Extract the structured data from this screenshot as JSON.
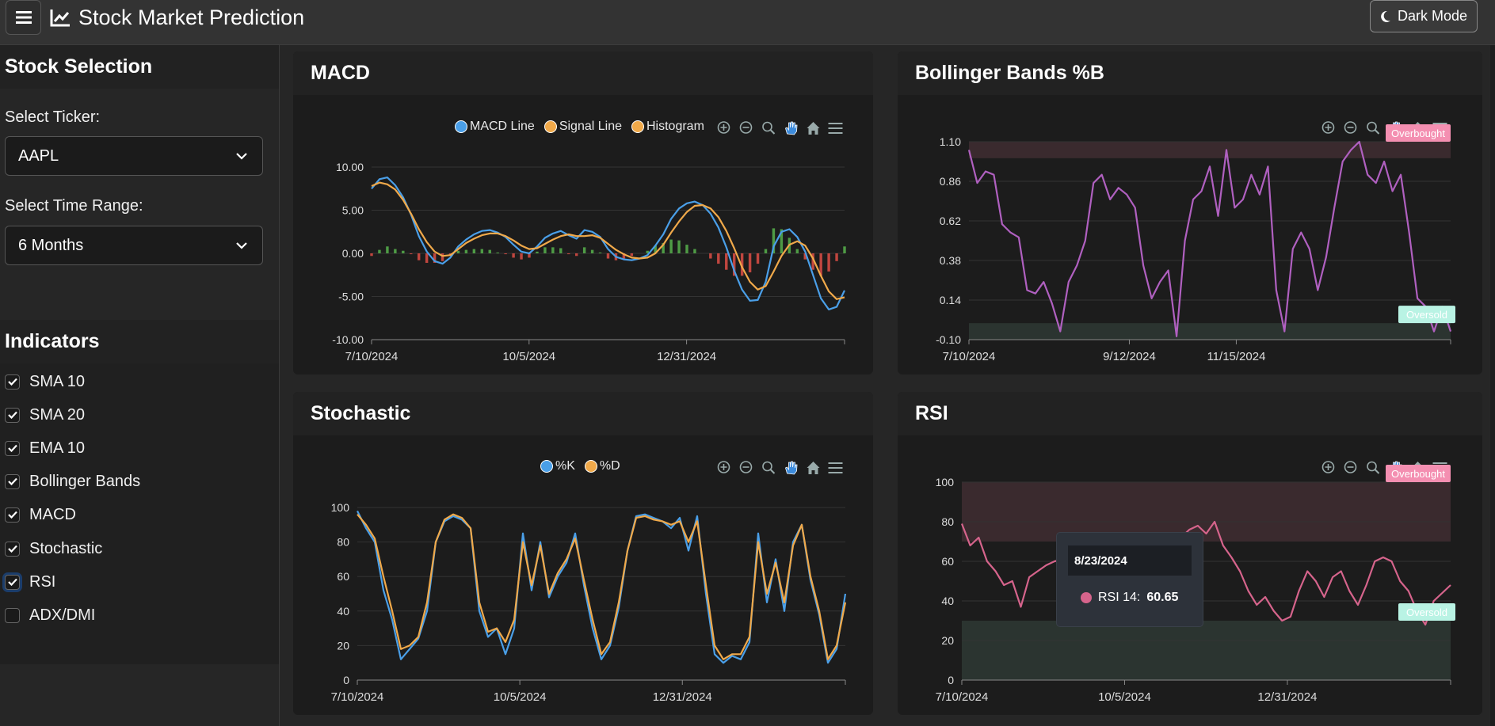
{
  "app": {
    "title": "Stock Market Prediction",
    "dark_mode_label": "Dark Mode"
  },
  "sidebar": {
    "stock_section_title": "Stock Selection",
    "ticker_label": "Select Ticker:",
    "ticker_value": "AAPL",
    "range_label": "Select Time Range:",
    "range_value": "6 Months",
    "indicators_title": "Indicators",
    "indicators": [
      {
        "label": "SMA 10",
        "checked": true
      },
      {
        "label": "SMA 20",
        "checked": true
      },
      {
        "label": "EMA 10",
        "checked": true
      },
      {
        "label": "Bollinger Bands",
        "checked": true
      },
      {
        "label": "MACD",
        "checked": true
      },
      {
        "label": "Stochastic",
        "checked": true
      },
      {
        "label": "RSI",
        "checked": true,
        "focused": true
      },
      {
        "label": "ADX/DMI",
        "checked": false
      }
    ]
  },
  "panels": {
    "macd": {
      "title": "MACD"
    },
    "bollinger": {
      "title": "Bollinger Bands %B",
      "overbought_label": "Overbought",
      "oversold_label": "Oversold"
    },
    "stochastic": {
      "title": "Stochastic"
    },
    "rsi": {
      "title": "RSI",
      "overbought_label": "Overbought",
      "oversold_label": "Oversold"
    }
  },
  "tooltip": {
    "date": "8/23/2024",
    "series": "RSI 14:",
    "value": "60.65",
    "color": "#d6648c"
  },
  "colors": {
    "blue": "#4a9fe8",
    "orange": "#f0a94a",
    "purple": "#b060c0",
    "pink": "#d6648c",
    "green_bar": "#4e9b45",
    "red_bar": "#c0463f"
  },
  "chart_data": [
    {
      "type": "line",
      "title": "MACD",
      "x_ticks": [
        "7/10/2024",
        "10/5/2024",
        "12/31/2024"
      ],
      "y_ticks": [
        "10.00",
        "5.00",
        "0.00",
        "-5.00",
        "-10.00"
      ],
      "ylim": [
        -10,
        10
      ],
      "legend": [
        "MACD Line",
        "Signal Line",
        "Histogram"
      ],
      "series": [
        {
          "name": "MACD Line",
          "color": "#4a9fe8",
          "values": [
            7.5,
            8.6,
            8.8,
            7.9,
            6.5,
            4.5,
            2.0,
            0.2,
            -0.9,
            -1.2,
            -0.5,
            0.8,
            1.6,
            2.2,
            2.6,
            2.7,
            2.4,
            1.9,
            1.0,
            0.2,
            0.0,
            0.8,
            1.8,
            2.3,
            2.6,
            2.1,
            1.7,
            2.7,
            2.5,
            1.9,
            0.5,
            -0.4,
            -0.7,
            -0.8,
            -0.6,
            -0.2,
            0.9,
            2.2,
            4.0,
            5.2,
            5.8,
            6.0,
            5.6,
            4.6,
            3.0,
            0.7,
            -2.0,
            -4.2,
            -5.5,
            -5.4,
            -3.3,
            0.8,
            2.5,
            2.8,
            1.9,
            0.2,
            -2.5,
            -5.2,
            -6.5,
            -6.2,
            -4.3
          ]
        },
        {
          "name": "Signal Line",
          "color": "#f0a94a",
          "values": [
            7.8,
            8.2,
            8.0,
            7.4,
            6.2,
            4.6,
            2.8,
            1.3,
            0.2,
            -0.3,
            -0.2,
            0.5,
            1.2,
            1.7,
            2.1,
            2.3,
            2.3,
            2.0,
            1.5,
            0.9,
            0.5,
            0.6,
            1.1,
            1.6,
            2.0,
            2.2,
            2.0,
            2.0,
            2.1,
            1.8,
            1.1,
            0.4,
            -0.1,
            -0.5,
            -0.6,
            -0.5,
            0.0,
            1.0,
            2.4,
            3.7,
            4.8,
            5.5,
            5.6,
            5.2,
            4.2,
            2.6,
            0.6,
            -1.6,
            -3.3,
            -4.2,
            -3.8,
            -2.1,
            -0.3,
            1.0,
            1.4,
            0.9,
            -0.6,
            -2.6,
            -4.4,
            -5.3,
            -5.1
          ]
        },
        {
          "name": "Histogram",
          "color": "#f0a94a",
          "values": [
            -0.3,
            0.4,
            0.8,
            0.5,
            0.3,
            -0.1,
            -0.8,
            -1.1,
            -1.1,
            -0.9,
            -0.3,
            0.3,
            0.4,
            0.5,
            0.5,
            0.4,
            0.1,
            -0.1,
            -0.5,
            -0.7,
            -0.5,
            0.2,
            0.7,
            0.7,
            0.6,
            -0.1,
            -0.3,
            0.7,
            0.4,
            0.1,
            -0.6,
            -0.8,
            -0.6,
            -0.3,
            0.0,
            0.3,
            0.9,
            1.2,
            1.6,
            1.5,
            1.0,
            0.5,
            0.0,
            -0.6,
            -1.2,
            -1.9,
            -2.6,
            -2.6,
            -2.2,
            -1.2,
            0.5,
            2.9,
            2.8,
            1.8,
            0.5,
            -0.7,
            -1.9,
            -2.6,
            -2.1,
            -0.9,
            0.8
          ]
        }
      ]
    },
    {
      "type": "line",
      "title": "Bollinger Bands %B",
      "x_ticks": [
        "7/10/2024",
        "9/12/2024",
        "11/15/2024"
      ],
      "y_ticks": [
        "1.10",
        "0.86",
        "0.62",
        "0.38",
        "0.14",
        "-0.10"
      ],
      "ylim": [
        -0.1,
        1.1
      ],
      "bands": {
        "overbought": [
          1.0,
          1.1
        ],
        "oversold": [
          -0.1,
          0.0
        ]
      },
      "series": [
        {
          "name": "%B",
          "color": "#b060c0",
          "values": [
            1.05,
            0.85,
            0.92,
            0.9,
            0.6,
            0.55,
            0.52,
            0.2,
            0.18,
            0.25,
            0.12,
            -0.05,
            0.25,
            0.35,
            0.5,
            0.85,
            0.9,
            0.75,
            0.82,
            0.78,
            0.7,
            0.35,
            0.15,
            0.25,
            0.32,
            -0.08,
            0.5,
            0.75,
            0.8,
            0.95,
            0.65,
            1.05,
            0.7,
            0.75,
            0.9,
            0.78,
            0.95,
            0.2,
            -0.05,
            0.45,
            0.55,
            0.45,
            0.2,
            0.4,
            0.7,
            0.98,
            1.05,
            1.1,
            0.9,
            0.85,
            0.98,
            0.8,
            0.9,
            0.55,
            0.15,
            0.1,
            -0.05,
            0.1,
            -0.05
          ]
        }
      ]
    },
    {
      "type": "line",
      "title": "Stochastic",
      "x_ticks": [
        "7/10/2024",
        "10/5/2024",
        "12/31/2024"
      ],
      "y_ticks": [
        "100",
        "80",
        "60",
        "40",
        "20",
        "0"
      ],
      "ylim": [
        0,
        100
      ],
      "legend": [
        "%K",
        "%D"
      ],
      "series": [
        {
          "name": "%K",
          "color": "#4a9fe8",
          "values": [
            98,
            88,
            80,
            52,
            35,
            12,
            18,
            24,
            40,
            80,
            92,
            95,
            93,
            88,
            40,
            25,
            30,
            15,
            30,
            85,
            52,
            80,
            48,
            60,
            68,
            85,
            55,
            30,
            12,
            20,
            42,
            75,
            95,
            96,
            94,
            92,
            88,
            94,
            75,
            95,
            50,
            15,
            10,
            14,
            12,
            22,
            85,
            45,
            70,
            40,
            80,
            90,
            58,
            38,
            10,
            18,
            50
          ]
        },
        {
          "name": "%D",
          "color": "#f0a94a",
          "values": [
            96,
            90,
            82,
            60,
            40,
            18,
            20,
            25,
            45,
            80,
            93,
            96,
            94,
            88,
            45,
            28,
            30,
            22,
            35,
            80,
            55,
            78,
            50,
            62,
            70,
            82,
            58,
            35,
            15,
            22,
            45,
            75,
            94,
            95,
            93,
            92,
            90,
            92,
            80,
            92,
            55,
            20,
            12,
            15,
            15,
            25,
            80,
            50,
            68,
            45,
            78,
            90,
            60,
            40,
            12,
            20,
            45
          ]
        }
      ]
    },
    {
      "type": "line",
      "title": "RSI",
      "x_ticks": [
        "7/10/2024",
        "10/5/2024",
        "12/31/2024"
      ],
      "y_ticks": [
        "100",
        "80",
        "60",
        "40",
        "20",
        "0"
      ],
      "ylim": [
        0,
        100
      ],
      "bands": {
        "overbought": [
          70,
          100
        ],
        "oversold": [
          0,
          30
        ]
      },
      "series": [
        {
          "name": "RSI 14",
          "color": "#d6648c",
          "values": [
            79,
            68,
            72,
            60,
            55,
            48,
            50,
            37,
            52,
            55,
            58,
            60,
            61,
            62,
            60,
            58,
            62,
            57,
            52,
            55,
            50,
            58,
            62,
            60,
            64,
            68,
            72,
            76,
            78,
            74,
            80,
            68,
            62,
            55,
            45,
            38,
            42,
            35,
            30,
            32,
            45,
            55,
            50,
            42,
            52,
            55,
            45,
            38,
            48,
            60,
            62,
            60,
            50,
            45,
            35,
            28,
            40,
            44,
            48
          ]
        }
      ]
    }
  ]
}
